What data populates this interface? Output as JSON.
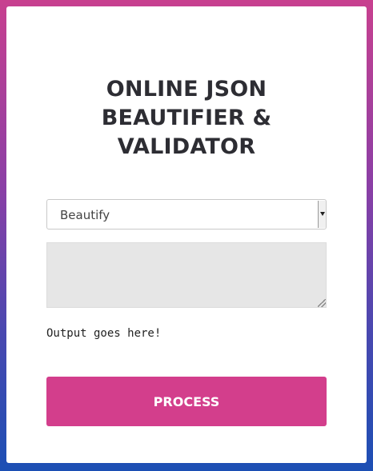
{
  "header": {
    "title_line1": "ONLINE JSON",
    "title_line2": "BEAUTIFIER &",
    "title_line3": "VALIDATOR"
  },
  "form": {
    "mode_select": {
      "selected": "Beautify"
    },
    "input_textarea": {
      "value": "",
      "placeholder": ""
    },
    "output_text": "Output goes here!",
    "process_label": "PROCESS"
  },
  "colors": {
    "accent": "#d33e8c",
    "gradient_top": "#c8408f",
    "gradient_bottom": "#1c4fb4",
    "textarea_bg": "#e6e6e6"
  }
}
